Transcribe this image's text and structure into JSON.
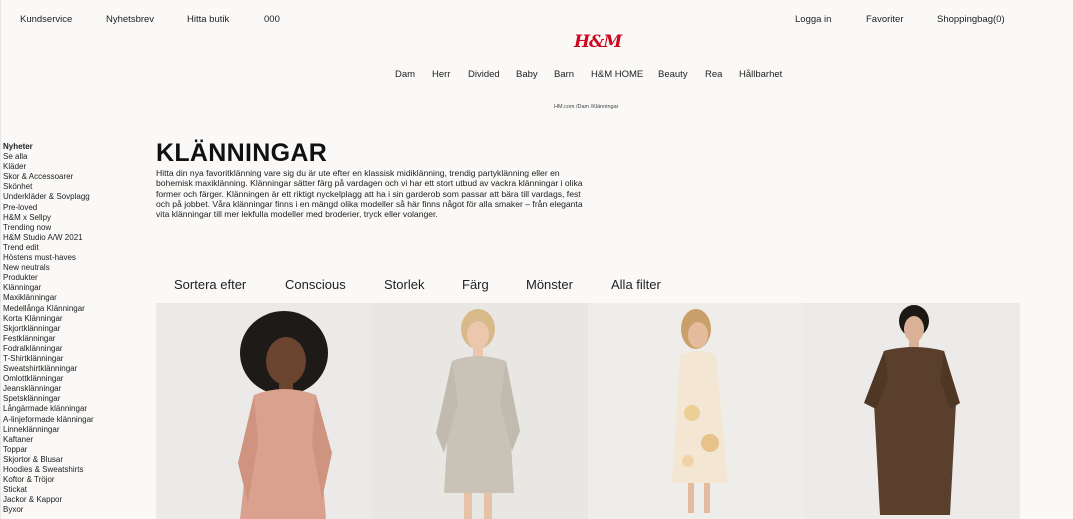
{
  "topbar": {
    "customer_service": "Kundservice",
    "newsletter": "Nyhetsbrev",
    "find_store": "Hitta butik",
    "code": "000",
    "login": "Logga in",
    "favorites": "Favoriter",
    "shopping_bag": "Shoppingbag(0)"
  },
  "logo": {
    "text": "H&M",
    "color": "#cc071e"
  },
  "main_nav": [
    "Dam",
    "Herr",
    "Divided",
    "Baby",
    "Barn",
    "H&M HOME",
    "Beauty",
    "Rea",
    "Hållbarhet"
  ],
  "breadcrumb": "HM.com /Dam /Klänningar",
  "sidebar": {
    "heading": "Nyheter",
    "items": [
      "Se alla",
      "Kläder",
      "Skor & Accessoarer",
      "Skönhet",
      "Underkläder & Sovplagg",
      "Pre-loved",
      "H&M x Sellpy",
      "Trending now",
      "H&M Studio A/W 2021",
      "Trend edit",
      "Höstens must-haves",
      "New neutrals",
      "Produkter",
      "Klänningar",
      "Maxiklänningar",
      "Medellånga Klänningar",
      "Korta Klänningar",
      "Skjortklänningar",
      "Festklänningar",
      "Fodralklänningar",
      "T-Shirtklänningar",
      "Sweatshirtklänningar",
      "Omlottklänningar",
      "Jeansklänningar",
      "Spetsklänningar",
      "Långärmade klänningar",
      "A-linjeformade klänningar",
      "Linneklänningar",
      "Kaftaner",
      "Toppar",
      "Skjortor & Blusar",
      "Hoodies & Sweatshirts",
      "Koftor & Tröjor",
      "Stickat",
      "Jackor & Kappor",
      "Byxor"
    ]
  },
  "page": {
    "title": "KLÄNNINGAR",
    "description": "Hitta din nya favoritklänning vare sig du är ute efter en klassisk midiklänning, trendig partyklänning eller en bohemisk maxiklänning. Klänningar sätter färg på vardagen och vi har ett stort utbud av vackra klänningar i olika former och färger. Klänningen är ett riktigt nyckelplagg att ha i sin garderob som passar att bära till vardags, fest och på jobbet. Våra klänningar finns i en mängd olika modeller så här finns något för alla smaker – från eleganta vita klänningar till mer lekfulla modeller med broderier, tryck eller volanger."
  },
  "filters": [
    "Sortera efter",
    "Conscious",
    "Storlek",
    "Färg",
    "Mönster",
    "Alla filter"
  ],
  "products": [
    {
      "image_icon": "model-pink-dress-image",
      "bg": "#eceae8",
      "dress_color": "#d9a18e"
    },
    {
      "image_icon": "model-knit-dress-image",
      "bg": "#e9e7e3",
      "dress_color": "#c9c2b7"
    },
    {
      "image_icon": "model-floral-dress-image",
      "bg": "#efedea",
      "dress_color": "#f3e7d3"
    },
    {
      "image_icon": "model-brown-dress-image",
      "bg": "#ecebe9",
      "dress_color": "#5a3f2c"
    }
  ]
}
